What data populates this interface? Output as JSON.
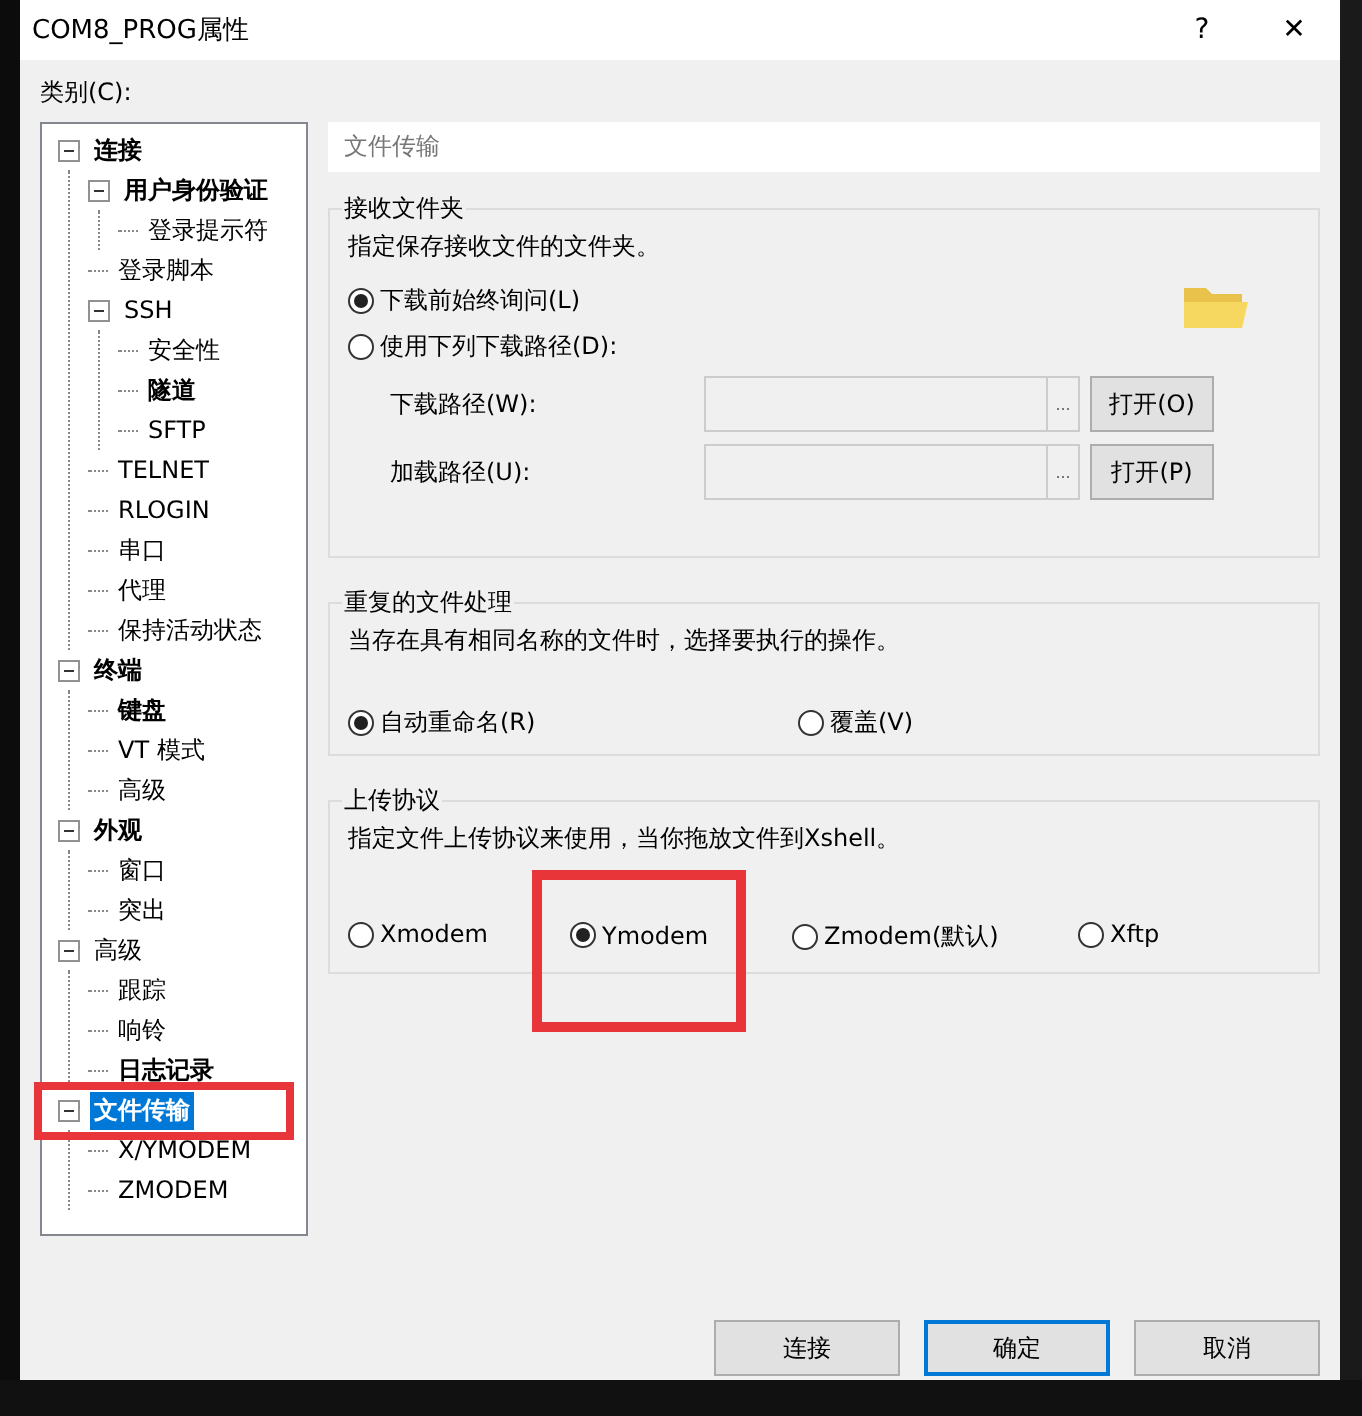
{
  "window": {
    "title": "COM8_PROG属性",
    "help_button": "?",
    "close_button": "✕"
  },
  "category_label": "类别(C):",
  "tree": [
    {
      "label": "连接",
      "bold": true,
      "expanded": true,
      "selected": false,
      "highlighted": false,
      "children": [
        {
          "label": "用户身份验证",
          "bold": true,
          "expanded": true,
          "selected": false,
          "highlighted": false,
          "children": [
            {
              "label": "登录提示符",
              "bold": false,
              "selected": false,
              "highlighted": false
            }
          ]
        },
        {
          "label": "登录脚本",
          "bold": false,
          "selected": false,
          "highlighted": false
        },
        {
          "label": "SSH",
          "bold": false,
          "expanded": true,
          "selected": false,
          "highlighted": false,
          "children": [
            {
              "label": "安全性",
              "bold": false,
              "selected": false,
              "highlighted": false
            },
            {
              "label": "隧道",
              "bold": true,
              "selected": false,
              "highlighted": false
            },
            {
              "label": "SFTP",
              "bold": false,
              "selected": false,
              "highlighted": false
            }
          ]
        },
        {
          "label": "TELNET",
          "bold": false,
          "selected": false,
          "highlighted": false
        },
        {
          "label": "RLOGIN",
          "bold": false,
          "selected": false,
          "highlighted": false
        },
        {
          "label": "串口",
          "bold": false,
          "selected": false,
          "highlighted": false
        },
        {
          "label": "代理",
          "bold": false,
          "selected": false,
          "highlighted": false
        },
        {
          "label": "保持活动状态",
          "bold": false,
          "selected": false,
          "highlighted": false
        }
      ]
    },
    {
      "label": "终端",
      "bold": true,
      "expanded": true,
      "selected": false,
      "highlighted": false,
      "children": [
        {
          "label": "键盘",
          "bold": true,
          "selected": false,
          "highlighted": false
        },
        {
          "label": "VT 模式",
          "bold": false,
          "selected": false,
          "highlighted": false
        },
        {
          "label": "高级",
          "bold": false,
          "selected": false,
          "highlighted": false
        }
      ]
    },
    {
      "label": "外观",
      "bold": true,
      "expanded": true,
      "selected": false,
      "highlighted": false,
      "children": [
        {
          "label": "窗口",
          "bold": false,
          "selected": false,
          "highlighted": false
        },
        {
          "label": "突出",
          "bold": false,
          "selected": false,
          "highlighted": false
        }
      ]
    },
    {
      "label": "高级",
      "bold": false,
      "expanded": true,
      "selected": false,
      "highlighted": false,
      "children": [
        {
          "label": "跟踪",
          "bold": false,
          "selected": false,
          "highlighted": false
        },
        {
          "label": "响铃",
          "bold": false,
          "selected": false,
          "highlighted": false
        },
        {
          "label": "日志记录",
          "bold": true,
          "selected": false,
          "highlighted": false
        }
      ]
    },
    {
      "label": "文件传输",
      "bold": true,
      "expanded": true,
      "selected": true,
      "highlighted": true,
      "children": [
        {
          "label": "X/YMODEM",
          "bold": false,
          "selected": false,
          "highlighted": false
        },
        {
          "label": "ZMODEM",
          "bold": false,
          "selected": false,
          "highlighted": false
        }
      ]
    }
  ],
  "panel": {
    "header": "文件传输",
    "receive_folder": {
      "title": "接收文件夹",
      "description": "指定保存接收文件的文件夹。",
      "options": [
        {
          "label": "下载前始终询问(L)",
          "selected": true,
          "highlighted": false
        },
        {
          "label": "使用下列下载路径(D):",
          "selected": false,
          "highlighted": false
        }
      ],
      "paths": [
        {
          "label": "下载路径(W):",
          "browse": "...",
          "button": "打开(O)"
        },
        {
          "label": "加载路径(U):",
          "browse": "...",
          "button": "打开(P)"
        }
      ]
    },
    "duplicate_handling": {
      "title": "重复的文件处理",
      "description": "当存在具有相同名称的文件时，选择要执行的操作。",
      "options": [
        {
          "label": "自动重命名(R)",
          "selected": true,
          "highlighted": false
        },
        {
          "label": "覆盖(V)",
          "selected": false,
          "highlighted": false
        }
      ]
    },
    "upload_protocol": {
      "title": "上传协议",
      "description": "指定文件上传协议来使用，当你拖放文件到Xshell。",
      "options": [
        {
          "label": "Xmodem",
          "selected": false,
          "highlighted": false
        },
        {
          "label": "Ymodem",
          "selected": true,
          "highlighted": true
        },
        {
          "label": "Zmodem(默认)",
          "selected": false,
          "highlighted": false
        },
        {
          "label": "Xftp",
          "selected": false,
          "highlighted": false
        }
      ]
    }
  },
  "buttons": [
    {
      "label": "连接",
      "focused": false
    },
    {
      "label": "确定",
      "focused": true
    },
    {
      "label": "取消",
      "focused": false
    }
  ]
}
